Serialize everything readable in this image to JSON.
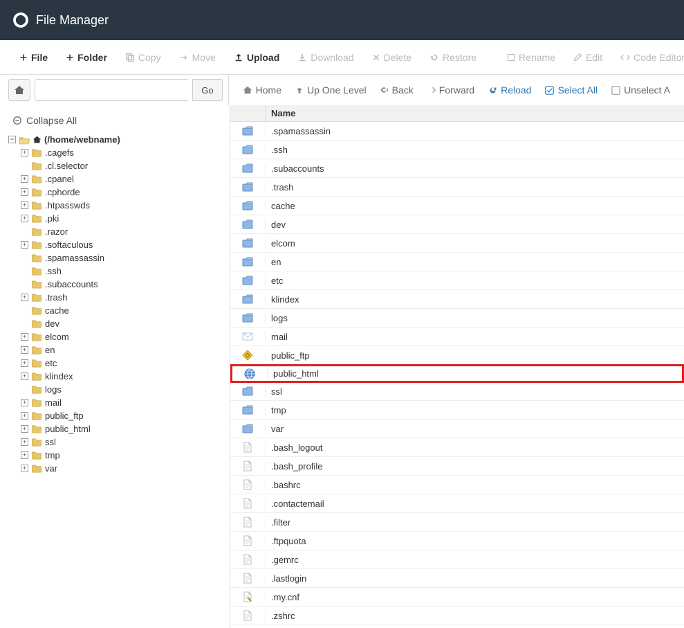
{
  "header": {
    "title": "File Manager"
  },
  "toolbar": {
    "file": "File",
    "folder": "Folder",
    "copy": "Copy",
    "move": "Move",
    "upload": "Upload",
    "download": "Download",
    "delete": "Delete",
    "restore": "Restore",
    "rename": "Rename",
    "edit": "Edit",
    "codeeditor": "Code Editor"
  },
  "nav": {
    "go": "Go",
    "home": "Home",
    "up": "Up One Level",
    "back": "Back",
    "forward": "Forward",
    "reload": "Reload",
    "selectall": "Select All",
    "unselectall": "Unselect A"
  },
  "sidebar": {
    "collapse": "Collapse All",
    "root": "(/home/webname)",
    "items": [
      {
        "label": ".cagefs",
        "expandable": true
      },
      {
        "label": ".cl.selector",
        "expandable": false
      },
      {
        "label": ".cpanel",
        "expandable": true
      },
      {
        "label": ".cphorde",
        "expandable": true
      },
      {
        "label": ".htpasswds",
        "expandable": true
      },
      {
        "label": ".pki",
        "expandable": true
      },
      {
        "label": ".razor",
        "expandable": false
      },
      {
        "label": ".softaculous",
        "expandable": true
      },
      {
        "label": ".spamassassin",
        "expandable": false
      },
      {
        "label": ".ssh",
        "expandable": false
      },
      {
        "label": ".subaccounts",
        "expandable": false
      },
      {
        "label": ".trash",
        "expandable": true
      },
      {
        "label": "cache",
        "expandable": false
      },
      {
        "label": "dev",
        "expandable": false
      },
      {
        "label": "elcom",
        "expandable": true
      },
      {
        "label": "en",
        "expandable": true
      },
      {
        "label": "etc",
        "expandable": true
      },
      {
        "label": "klindex",
        "expandable": true
      },
      {
        "label": "logs",
        "expandable": false
      },
      {
        "label": "mail",
        "expandable": true
      },
      {
        "label": "public_ftp",
        "expandable": true
      },
      {
        "label": "public_html",
        "expandable": true
      },
      {
        "label": "ssl",
        "expandable": true
      },
      {
        "label": "tmp",
        "expandable": true
      },
      {
        "label": "var",
        "expandable": true
      }
    ]
  },
  "files": {
    "header": "Name",
    "rows": [
      {
        "name": ".spamassassin",
        "icon": "folder",
        "highlight": false
      },
      {
        "name": ".ssh",
        "icon": "folder",
        "highlight": false
      },
      {
        "name": ".subaccounts",
        "icon": "folder",
        "highlight": false
      },
      {
        "name": ".trash",
        "icon": "folder",
        "highlight": false
      },
      {
        "name": "cache",
        "icon": "folder",
        "highlight": false
      },
      {
        "name": "dev",
        "icon": "folder",
        "highlight": false
      },
      {
        "name": "elcom",
        "icon": "folder",
        "highlight": false
      },
      {
        "name": "en",
        "icon": "folder",
        "highlight": false
      },
      {
        "name": "etc",
        "icon": "folder",
        "highlight": false
      },
      {
        "name": "klindex",
        "icon": "folder",
        "highlight": false
      },
      {
        "name": "logs",
        "icon": "folder",
        "highlight": false
      },
      {
        "name": "mail",
        "icon": "mail",
        "highlight": false
      },
      {
        "name": "public_ftp",
        "icon": "ftp",
        "highlight": false
      },
      {
        "name": "public_html",
        "icon": "globe",
        "highlight": true
      },
      {
        "name": "ssl",
        "icon": "folder",
        "highlight": false
      },
      {
        "name": "tmp",
        "icon": "folder",
        "highlight": false
      },
      {
        "name": "var",
        "icon": "folder",
        "highlight": false
      },
      {
        "name": ".bash_logout",
        "icon": "file",
        "highlight": false
      },
      {
        "name": ".bash_profile",
        "icon": "file",
        "highlight": false
      },
      {
        "name": ".bashrc",
        "icon": "file",
        "highlight": false
      },
      {
        "name": ".contactemail",
        "icon": "file",
        "highlight": false
      },
      {
        "name": ".filter",
        "icon": "file",
        "highlight": false
      },
      {
        "name": ".ftpquota",
        "icon": "file",
        "highlight": false
      },
      {
        "name": ".gemrc",
        "icon": "file",
        "highlight": false
      },
      {
        "name": ".lastlogin",
        "icon": "file",
        "highlight": false
      },
      {
        "name": ".my.cnf",
        "icon": "file-edit",
        "highlight": false
      },
      {
        "name": ".zshrc",
        "icon": "file",
        "highlight": false
      }
    ]
  }
}
